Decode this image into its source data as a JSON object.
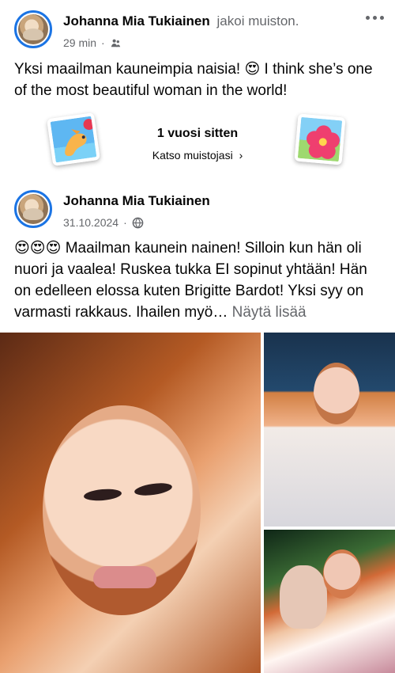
{
  "post1": {
    "author": "Johanna Mia Tukiainen",
    "action": "jakoi muiston.",
    "time": "29 min",
    "text": "Yksi maailman kauneimpia naisia! 😍 I think she’s one of the most beautiful woman in the world!"
  },
  "memory": {
    "title": "1 vuosi sitten",
    "link": "Katso muistojasi"
  },
  "post2": {
    "author": "Johanna Mia Tukiainen",
    "date": "31.10.2024",
    "emojis": "😍😍😍",
    "text": "Maailman kaunein nainen! Silloin kun hän oli nuori ja vaalea! Ruskea tukka EI sopinut yhtään! Hän on edelleen elossa kuten Brigitte Bardot! Yksi syy on varmasti rakkaus. Ihailen myö…",
    "see_more": "Näytä lisää"
  },
  "colors": {
    "facebook_blue": "#1b74e4",
    "secondary_text": "#65676b",
    "primary_text": "#050505"
  },
  "icons": {
    "more": "more-options-icon",
    "friends": "friends-icon",
    "public": "globe-icon",
    "memory_left": "dog-photo-memory-icon",
    "memory_right": "hibiscus-photo-memory-icon",
    "chevron": "chevron-right-icon"
  }
}
